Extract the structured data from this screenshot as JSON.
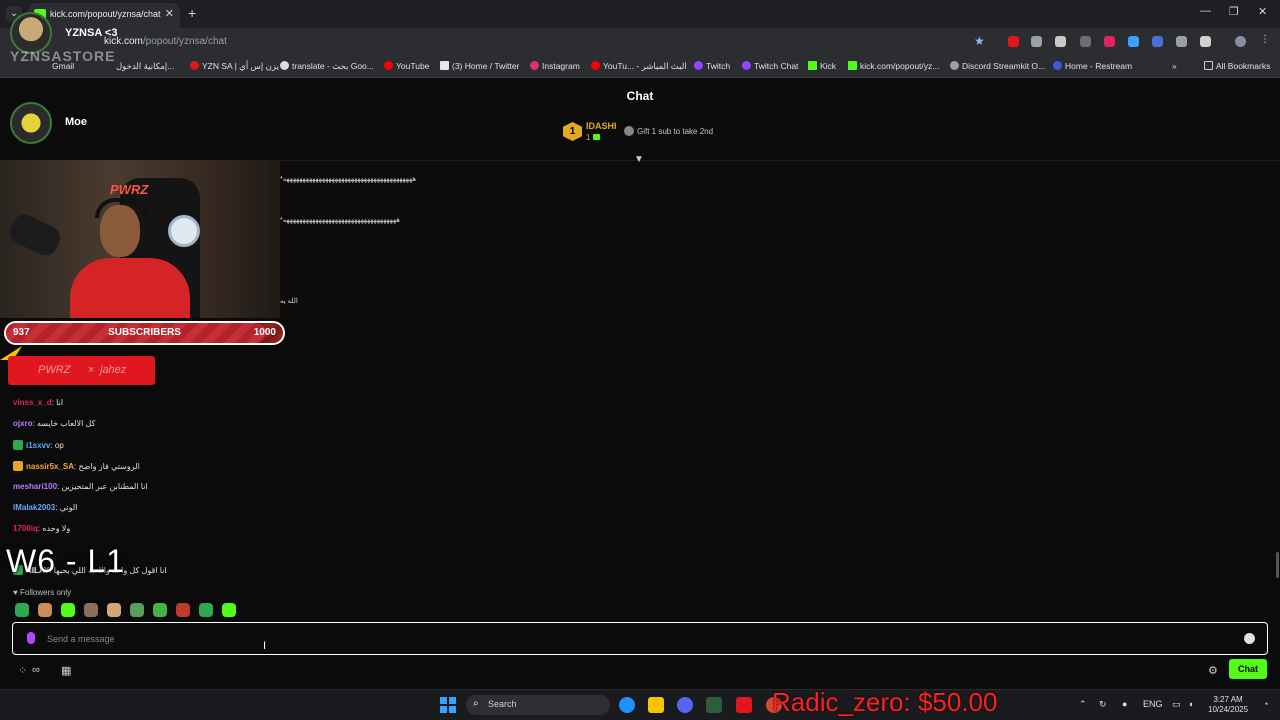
{
  "browser": {
    "tab_title": "kick.com/popout/yznsa/chat",
    "url_prefix": "kick.com",
    "url_path": "/popout/yznsa/chat",
    "bookmarks": [
      "Gmail",
      "إمكانية الدخول...",
      "YZN SA | يزن إس أي",
      "translate - بحث Goo...",
      "YouTube",
      "(3) Home / Twitter",
      "Instagram",
      "YouTu... - البث المباشر",
      "Twitch",
      "Twitch Chat",
      "Kick",
      "kick.com/popout/yz...",
      "Discord Streamkit O...",
      "Home - Restream"
    ],
    "all_bookmarks": "All Bookmarks"
  },
  "overlay": {
    "top_user": "YZNSA <3",
    "second_user": "Moe",
    "store_watermark": "YZNSASTORE",
    "subgoal": {
      "current": "937",
      "label": "SUBSCRIBERS",
      "target": "1000",
      "progress": 0.937
    },
    "sponsor": {
      "left": "PWRZ",
      "x": "×",
      "right": "jahez"
    },
    "score": "W6 - L1",
    "donation": "Radic_zero: $50.00"
  },
  "chat": {
    "title": "Chat",
    "leaderboard": {
      "rank": "1",
      "name": "IDASHI",
      "count": "1"
    },
    "gift_text": "Gift 1 sub to take 2nd",
    "streaks": [
      "*ههههههههههههههههههههههههههههههههههههههههه",
      "*هههههههههههههههههههههههههههههههههههه"
    ],
    "short_msg": "الله يه",
    "messages": [
      {
        "user": "vinss_x_d",
        "text": "انا",
        "color": "#e0245e",
        "badge": ""
      },
      {
        "user": "ojxro",
        "text": "كل الالعاب خايسه",
        "color": "#b57bff",
        "badge": ""
      },
      {
        "user": "i1sxvv",
        "text": "op",
        "color": "#4fb0ff",
        "badge": "#2fa84f"
      },
      {
        "user": "nassir5x_SA",
        "text": "الروستي فاز واضح",
        "color": "#f2a93b",
        "badge": "#e3a920"
      },
      {
        "user": "meshari100",
        "text": "انا المطنابن عبر المتحيزين",
        "color": "#b57bff",
        "badge": ""
      },
      {
        "user": "lMalak2003",
        "text": "الوني",
        "color": "#6aa8ff",
        "badge": ""
      },
      {
        "user": "1700iq",
        "text": "ولا وحده",
        "color": "#e0245e",
        "badge": ""
      },
      {
        "user": "NILAY",
        "text": "انا اقول كل واحد واللعبة اللي يحبها",
        "color": "#ffffff",
        "badge": "#2fa84f"
      }
    ],
    "followers_only": "Followers only",
    "input_placeholder": "Send a message",
    "send_label": "Chat"
  },
  "taskbar": {
    "search_placeholder": "Search",
    "lang": "ENG",
    "time": "3:27 AM",
    "date": "10/24/2025"
  },
  "colors": {
    "kick_green": "#53fc18",
    "accent_red": "#e0171f",
    "gold": "#e3a920"
  }
}
